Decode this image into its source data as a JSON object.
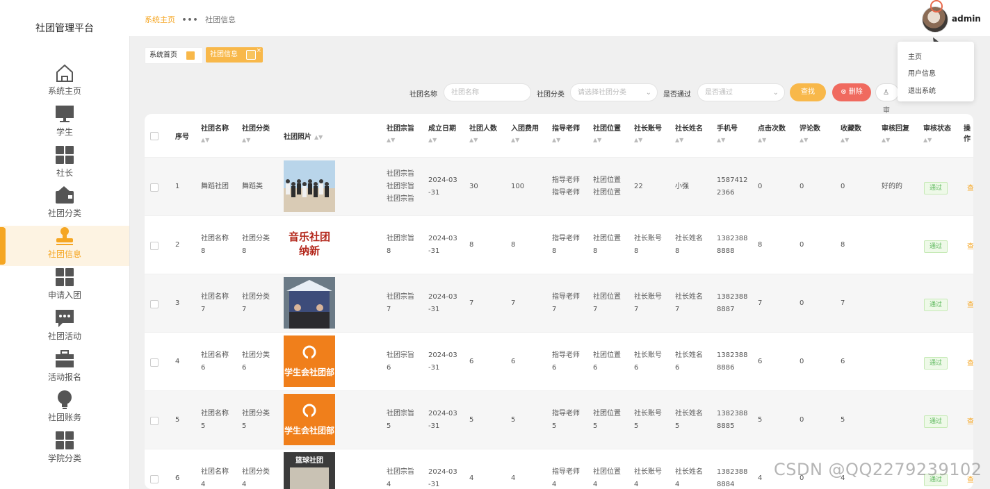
{
  "sidebar": {
    "title": "社团管理平台",
    "items": [
      {
        "label": "系统主页",
        "icon": "home-icon"
      },
      {
        "label": "学生",
        "icon": "monitor-icon"
      },
      {
        "label": "社长",
        "icon": "grid-icon"
      },
      {
        "label": "社团分类",
        "icon": "wallet-icon"
      },
      {
        "label": "社团信息",
        "icon": "stamp-icon",
        "active": true
      },
      {
        "label": "申请入团",
        "icon": "grid-icon"
      },
      {
        "label": "社团活动",
        "icon": "chat-icon"
      },
      {
        "label": "活动报名",
        "icon": "briefcase-icon"
      },
      {
        "label": "社团账务",
        "icon": "bulb-icon"
      },
      {
        "label": "学院分类",
        "icon": "grid-icon"
      }
    ]
  },
  "header": {
    "breadcrumb_home": "系统主页",
    "breadcrumb_sep": "•••",
    "breadcrumb_current": "社团信息",
    "username": "admin"
  },
  "dropdown": [
    "主页",
    "用户信息",
    "退出系统"
  ],
  "tabs": [
    "系统首页",
    "社团信息"
  ],
  "search": {
    "name_label": "社团名称",
    "name_placeholder": "社团名称",
    "cat_label": "社团分类",
    "cat_placeholder": "请选择社团分类",
    "pass_label": "是否通过",
    "pass_placeholder": "是否通过",
    "search_btn": "查找",
    "delete_btn": "删除",
    "audit_btn": "审"
  },
  "table": {
    "columns": [
      "序号",
      "社团名称",
      "社团分类",
      "社团照片",
      "社团宗旨",
      "成立日期",
      "社团人数",
      "入团费用",
      "指导老师",
      "社团位置",
      "社长账号",
      "社长姓名",
      "手机号",
      "点击次数",
      "评论数",
      "收藏数",
      "审核回复",
      "审核状态",
      "操作"
    ],
    "rows": [
      {
        "no": "1",
        "name": [
          "舞蹈社团"
        ],
        "cat": [
          "舞蹈类"
        ],
        "photo": "dance",
        "purpose": [
          "社团宗旨",
          "社团宗旨",
          "社团宗旨"
        ],
        "date": [
          "2024-03",
          "-31"
        ],
        "members": "30",
        "fee": "100",
        "teacher": [
          "指导老师",
          "指导老师"
        ],
        "loc": [
          "社团位置",
          "社团位置"
        ],
        "acct": [
          "22"
        ],
        "leader": [
          "小强"
        ],
        "phone": [
          "1587412",
          "2366"
        ],
        "clicks": "0",
        "comments": "0",
        "favs": "0",
        "reply": "好的的",
        "status": "通过",
        "op": "查"
      },
      {
        "no": "2",
        "name": [
          "社团名称",
          "8"
        ],
        "cat": [
          "社团分类",
          "8"
        ],
        "photo": "music",
        "photo_text": [
          "音乐社团",
          "纳新"
        ],
        "purpose": [
          "社团宗旨",
          "8"
        ],
        "date": [
          "2024-03",
          "-31"
        ],
        "members": "8",
        "fee": "8",
        "teacher": [
          "指导老师",
          "8"
        ],
        "loc": [
          "社团位置",
          "8"
        ],
        "acct": [
          "社长账号",
          "8"
        ],
        "leader": [
          "社长姓名",
          "8"
        ],
        "phone": [
          "1382388",
          "8888"
        ],
        "clicks": "8",
        "comments": "0",
        "favs": "8",
        "reply": "",
        "status": "通过",
        "op": "查"
      },
      {
        "no": "3",
        "name": [
          "社团名称",
          "7"
        ],
        "cat": [
          "社团分类",
          "7"
        ],
        "photo": "booth",
        "purpose": [
          "社团宗旨",
          "7"
        ],
        "date": [
          "2024-03",
          "-31"
        ],
        "members": "7",
        "fee": "7",
        "teacher": [
          "指导老师",
          "7"
        ],
        "loc": [
          "社团位置",
          "7"
        ],
        "acct": [
          "社长账号",
          "7"
        ],
        "leader": [
          "社长姓名",
          "7"
        ],
        "phone": [
          "1382388",
          "8887"
        ],
        "clicks": "7",
        "comments": "0",
        "favs": "7",
        "reply": "",
        "status": "通过",
        "op": "查"
      },
      {
        "no": "4",
        "name": [
          "社团名称",
          "6"
        ],
        "cat": [
          "社团分类",
          "6"
        ],
        "photo": "orange",
        "photo_text": [
          "学生会社团部"
        ],
        "purpose": [
          "社团宗旨",
          "6"
        ],
        "date": [
          "2024-03",
          "-31"
        ],
        "members": "6",
        "fee": "6",
        "teacher": [
          "指导老师",
          "6"
        ],
        "loc": [
          "社团位置",
          "6"
        ],
        "acct": [
          "社长账号",
          "6"
        ],
        "leader": [
          "社长姓名",
          "6"
        ],
        "phone": [
          "1382388",
          "8886"
        ],
        "clicks": "6",
        "comments": "0",
        "favs": "6",
        "reply": "",
        "status": "通过",
        "op": "查"
      },
      {
        "no": "5",
        "name": [
          "社团名称",
          "5"
        ],
        "cat": [
          "社团分类",
          "5"
        ],
        "photo": "orange",
        "photo_text": [
          "学生会社团部"
        ],
        "purpose": [
          "社团宗旨",
          "5"
        ],
        "date": [
          "2024-03",
          "-31"
        ],
        "members": "5",
        "fee": "5",
        "teacher": [
          "指导老师",
          "5"
        ],
        "loc": [
          "社团位置",
          "5"
        ],
        "acct": [
          "社长账号",
          "5"
        ],
        "leader": [
          "社长姓名",
          "5"
        ],
        "phone": [
          "1382388",
          "8885"
        ],
        "clicks": "5",
        "comments": "0",
        "favs": "5",
        "reply": "",
        "status": "通过",
        "op": "查"
      },
      {
        "no": "6",
        "name": [
          "社团名称",
          "4"
        ],
        "cat": [
          "社团分类",
          "4"
        ],
        "photo": "poster",
        "photo_text": [
          "篮球社团"
        ],
        "purpose": [
          "社团宗旨",
          "4"
        ],
        "date": [
          "2024-03",
          "-31"
        ],
        "members": "4",
        "fee": "4",
        "teacher": [
          "指导老师",
          "4"
        ],
        "loc": [
          "社团位置",
          "4"
        ],
        "acct": [
          "社长账号",
          "4"
        ],
        "leader": [
          "社长姓名",
          "4"
        ],
        "phone": [
          "1382388",
          "8884"
        ],
        "clicks": "4",
        "comments": "0",
        "favs": "4",
        "reply": "",
        "status": "通过",
        "op": "查"
      }
    ]
  },
  "watermark": "CSDN @QQ2279239102",
  "colors": {
    "accent": "#f5a623",
    "danger": "#f06a5f",
    "success": "#5cb85c",
    "sidebar_bg": "#ffffff",
    "page_bg": "#f0f0f0"
  }
}
